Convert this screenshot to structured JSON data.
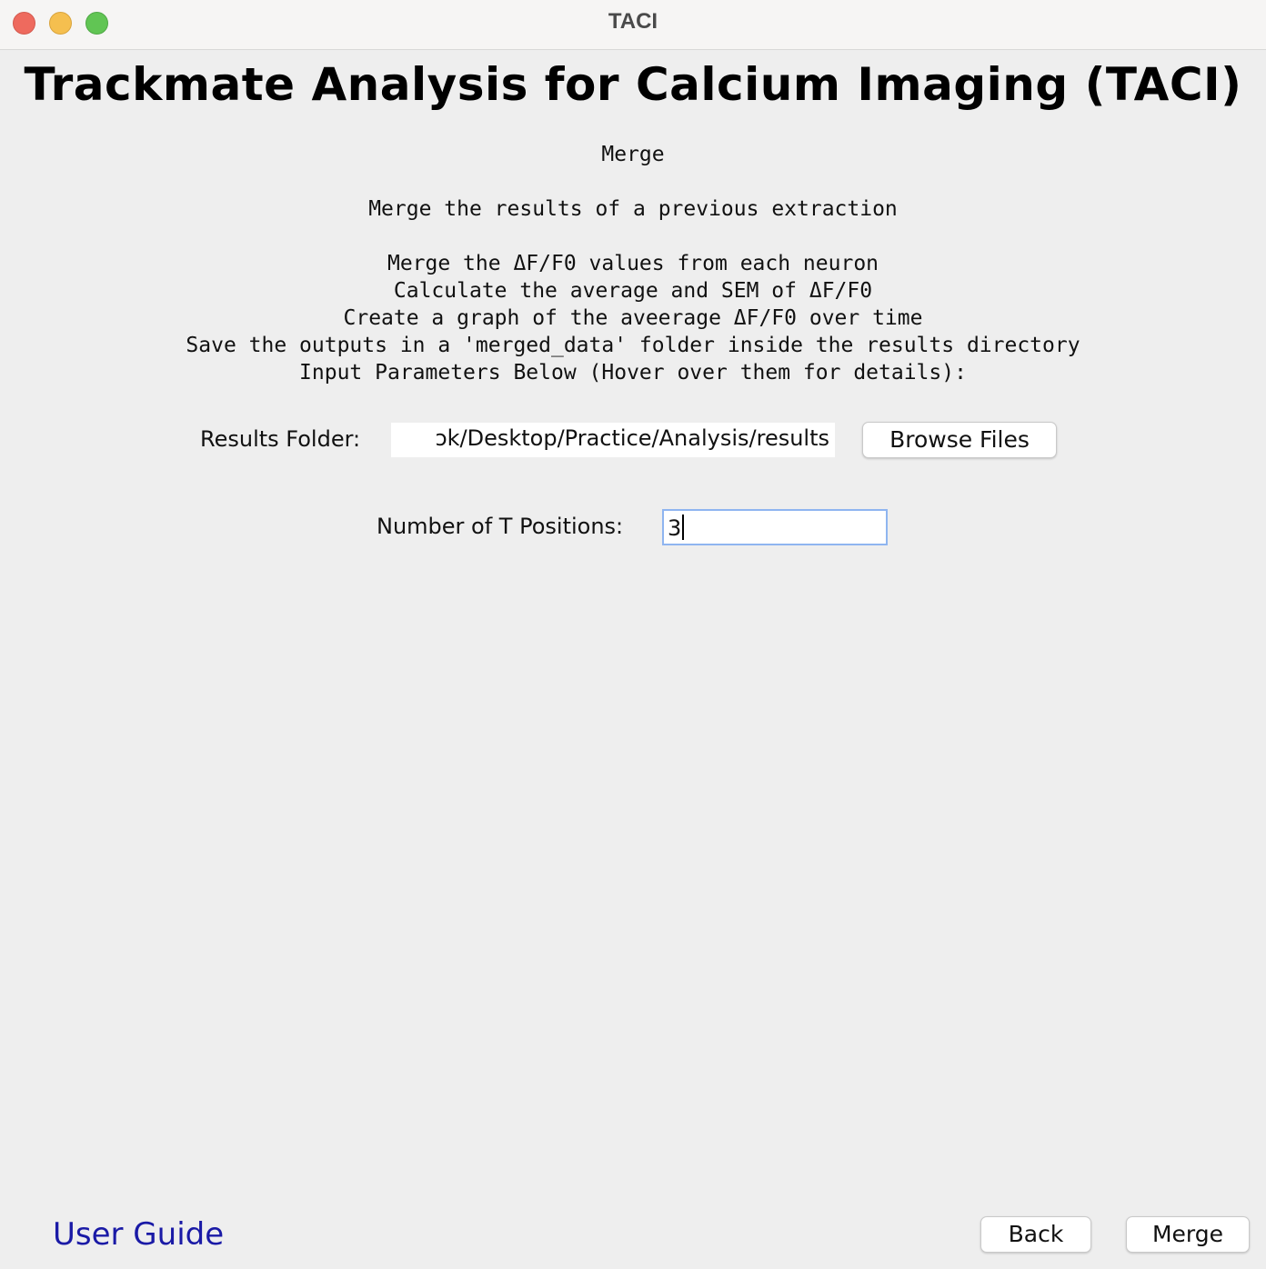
{
  "window": {
    "title": "TACI"
  },
  "header": {
    "app_title": "Trackmate Analysis for Calcium Imaging (TACI)"
  },
  "description": {
    "section": "Merge",
    "summary": "Merge the results of a previous extraction",
    "steps": [
      "Merge the ΔF/F0 values from each neuron",
      "Calculate the average and SEM of ΔF/F0",
      "Create a graph of the aveerage ΔF/F0 over time",
      "Save the outputs in a 'merged_data' folder inside the results directory",
      "Input Parameters Below (Hover over them for details):"
    ]
  },
  "form": {
    "results_folder": {
      "label": "Results Folder:",
      "value": "ɔk/Desktop/Practice/Analysis/results"
    },
    "browse_button": "Browse Files",
    "t_positions": {
      "label": "Number of T Positions:",
      "value": "3"
    }
  },
  "footer": {
    "user_guide": "User Guide",
    "back": "Back",
    "merge": "Merge"
  },
  "colors": {
    "link": "#1a1aa6",
    "focus_border": "#8fb5f0"
  }
}
